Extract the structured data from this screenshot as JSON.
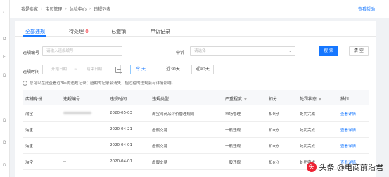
{
  "sidebar": {
    "items": [
      {
        "label": "‹"
      },
      {
        "label": "D"
      },
      {
        "label": "E"
      },
      {
        "label": "D"
      },
      {
        "label": "D"
      },
      {
        "label": "D"
      },
      {
        "label": "D"
      }
    ]
  },
  "breadcrumb": {
    "items": [
      "我是卖家",
      "宝贝管理",
      "体检中心",
      "违规列表"
    ],
    "separator": "›"
  },
  "help": {
    "label": "查看帮助"
  },
  "tabs": [
    {
      "label": "全部违规",
      "active": true
    },
    {
      "label": "待处理",
      "count": "0"
    },
    {
      "label": "已撤销"
    },
    {
      "label": "申诉记录"
    }
  ],
  "filters": {
    "violation_no": {
      "label": "违规编号",
      "placeholder": "请输入违规编号"
    },
    "appeal": {
      "label": "申诉",
      "placeholder": "请选择"
    },
    "violation_time": {
      "label": "违规时间",
      "start_placeholder": "开始日期",
      "end_placeholder": "结束日期",
      "range_sep": "~"
    },
    "search_label": "搜 索",
    "clear_label": "清 空",
    "quick_ranges": [
      "今 天",
      "近30天",
      "近90天"
    ]
  },
  "notice": "您可以在此查看近3年的违规记录；超期的记录会清失，但过往的违规会有详情影响。",
  "table": {
    "columns": [
      "店铺身份",
      "违规编号",
      "违规时间",
      "违规类型",
      "严重程度",
      "扣分",
      "处罚状态",
      "操作"
    ],
    "rows": [
      {
        "shop": "淘宝",
        "no": "",
        "time": "2020-05-03",
        "type": "淘宝网商品评价管理规则",
        "severity": "市场管理",
        "points": "扣0分",
        "status": "处罚完成",
        "action": "查看详情"
      },
      {
        "shop": "淘宝",
        "no": "--",
        "time": "2020-04-21",
        "type": "虚假交易",
        "severity": "一般违规",
        "points": "扣0分",
        "status": "处罚完成",
        "action": "查看详情"
      },
      {
        "shop": "淘宝",
        "no": "--",
        "time": "2020-04-01",
        "type": "虚假交易",
        "severity": "一般违规",
        "points": "扣0分",
        "status": "处罚完成",
        "action": "查看详情"
      },
      {
        "shop": "淘宝",
        "no": "--",
        "time": "2020-04-01",
        "type": "虚假交易",
        "severity": "一般违规",
        "points": "扣0分",
        "status": "处罚完成",
        "action": "查看详情"
      }
    ]
  },
  "watermark": {
    "text": "头条 @电商前沿君",
    "logo": "头"
  },
  "colors": {
    "accent": "#1677ff",
    "count": "#f5222d"
  }
}
